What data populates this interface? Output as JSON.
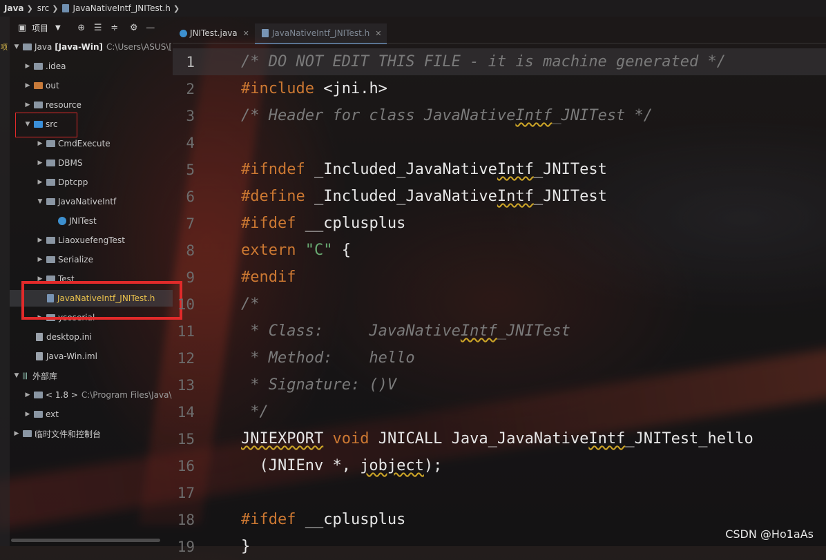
{
  "breadcrumb": {
    "project": "Java",
    "folder": "src",
    "file": "JavaNativeIntf_JNITest.h"
  },
  "left_stripe": {
    "label": "项"
  },
  "project_toolbar": {
    "title": "项目",
    "icons": [
      "project-icon",
      "caret-down-icon",
      "locate-icon",
      "expand-all-icon",
      "collapse-all-icon",
      "gear-icon",
      "minimize-icon"
    ]
  },
  "tree": [
    {
      "label": "Java",
      "extra": "[Java-Win]",
      "path": "C:\\Users\\ASUS\\[",
      "expanded": true,
      "kind": "module"
    },
    {
      "label": ".idea",
      "kind": "folder"
    },
    {
      "label": "out",
      "kind": "folder-orange"
    },
    {
      "label": "resource",
      "kind": "folder"
    },
    {
      "label": "src",
      "kind": "folder-blue",
      "expanded": true
    },
    {
      "label": "CmdExecute",
      "kind": "folder"
    },
    {
      "label": "DBMS",
      "kind": "folder"
    },
    {
      "label": "Dptcpp",
      "kind": "folder"
    },
    {
      "label": "JavaNativeIntf",
      "kind": "folder",
      "expanded": true
    },
    {
      "label": "JNITest",
      "kind": "java"
    },
    {
      "label": "LiaoxuefengTest",
      "kind": "folder"
    },
    {
      "label": "Serialize",
      "kind": "folder"
    },
    {
      "label": "Test",
      "kind": "folder"
    },
    {
      "label": "JavaNativeIntf_JNITest.h",
      "kind": "header",
      "selected": true
    },
    {
      "label": "ysoserial",
      "kind": "folder"
    },
    {
      "label": "desktop.ini",
      "kind": "file"
    },
    {
      "label": "Java-Win.iml",
      "kind": "file"
    },
    {
      "label": "外部库",
      "kind": "libraries",
      "expanded": true
    },
    {
      "label": "< 1.8 >",
      "path": "C:\\Program Files\\Java\\",
      "kind": "folder"
    },
    {
      "label": "ext",
      "kind": "folder"
    },
    {
      "label": "临时文件和控制台",
      "kind": "scratches"
    }
  ],
  "tabs": [
    {
      "label": "JNITest.java",
      "active": false
    },
    {
      "label": "JavaNativeIntf_JNITest.h",
      "active": true
    }
  ],
  "editor": {
    "line_numbers": [
      "1",
      "2",
      "3",
      "4",
      "5",
      "6",
      "7",
      "8",
      "9",
      "10",
      "11",
      "12",
      "13",
      "14",
      "15",
      "16",
      "17",
      "18",
      "19"
    ],
    "lines": [
      "/* DO NOT EDIT THIS FILE - it is machine generated */",
      "#include <jni.h>",
      "/* Header for class JavaNativeIntf_JNITest */",
      "",
      "#ifndef _Included_JavaNativeIntf_JNITest",
      "#define _Included_JavaNativeIntf_JNITest",
      "#ifdef __cplusplus",
      "extern \"C\" {",
      "#endif",
      "/*",
      " * Class:     JavaNativeIntf_JNITest",
      " * Method:    hello",
      " * Signature: ()V",
      " */",
      "JNIEXPORT void JNICALL Java_JavaNativeIntf_JNITest_hello",
      "  (JNIEnv *, jobject);",
      "",
      "#ifdef __cplusplus",
      "}"
    ]
  },
  "watermark": "CSDN @Ho1aAs",
  "colors": {
    "keyword": "#cc7832",
    "string": "#6aab73",
    "comment": "#7a7a7a",
    "highlight_box": "#e12a2a",
    "selected_file_text": "#e8c04c"
  }
}
